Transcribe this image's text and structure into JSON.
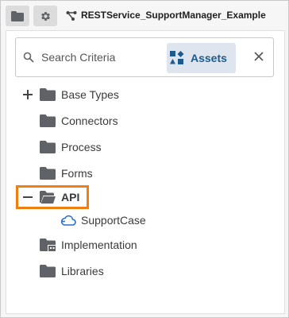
{
  "toolbar": {
    "folder_button_icon": "folder-icon",
    "settings_button_icon": "gear-icon",
    "project_icon": "service-graph-icon",
    "project_title": "RESTService_SupportManager_Example"
  },
  "search": {
    "placeholder": "Search Criteria",
    "value": "",
    "assets_label": "Assets",
    "assets_icon": "assets-icon",
    "clear_icon": "close-icon"
  },
  "tree": {
    "items": [
      {
        "label": "Base Types",
        "icon": "folder-icon",
        "expander": "plus"
      },
      {
        "label": "Connectors",
        "icon": "folder-icon"
      },
      {
        "label": "Process",
        "icon": "folder-icon"
      },
      {
        "label": "Forms",
        "icon": "folder-icon"
      },
      {
        "label": "API",
        "icon": "folder-open-icon",
        "expander": "minus",
        "highlighted": true
      },
      {
        "label": "SupportCase",
        "icon": "cloud-api-icon",
        "child_of": "API"
      },
      {
        "label": "Implementation",
        "icon": "folder-building-icon"
      },
      {
        "label": "Libraries",
        "icon": "folder-icon"
      }
    ]
  },
  "colors": {
    "highlight": "#f07e10",
    "folder": "#5f6368",
    "assets_text": "#1d5a8e",
    "assets_bg": "#dfe5ee",
    "api_icon": "#2a6fc9"
  }
}
